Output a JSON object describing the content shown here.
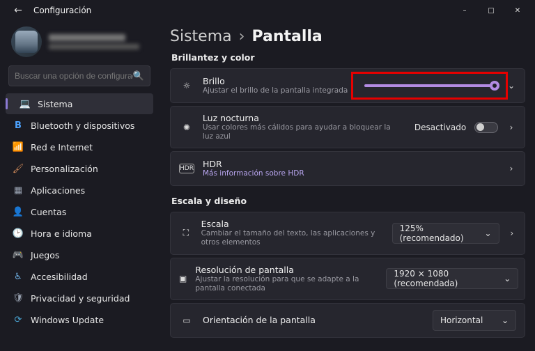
{
  "window": {
    "title": "Configuración",
    "minimize": "–",
    "maximize": "□",
    "close": "✕",
    "back": "←"
  },
  "sidebar": {
    "search_placeholder": "Buscar una opción de configuración",
    "items": [
      {
        "label": "Sistema",
        "icon": "💻",
        "active": true
      },
      {
        "label": "Bluetooth y dispositivos",
        "icon": "B"
      },
      {
        "label": "Red e Internet",
        "icon": "📶"
      },
      {
        "label": "Personalización",
        "icon": "🖌"
      },
      {
        "label": "Aplicaciones",
        "icon": "▦"
      },
      {
        "label": "Cuentas",
        "icon": "👤"
      },
      {
        "label": "Hora e idioma",
        "icon": "🕑"
      },
      {
        "label": "Juegos",
        "icon": "🎮"
      },
      {
        "label": "Accesibilidad",
        "icon": "♿"
      },
      {
        "label": "Privacidad y seguridad",
        "icon": "🛡"
      },
      {
        "label": "Windows Update",
        "icon": "⟳"
      }
    ]
  },
  "main": {
    "breadcrumb": {
      "parent": "Sistema",
      "sep": "›",
      "current": "Pantalla"
    },
    "sections": {
      "brightness_color": "Brillantez y color",
      "scale_layout": "Escala y diseño"
    },
    "brightness": {
      "title": "Brillo",
      "sub": "Ajustar el brillo de la pantalla integrada",
      "icon": "☼",
      "value_percent": 98
    },
    "nightlight": {
      "title": "Luz nocturna",
      "sub": "Usar colores más cálidos para ayudar a bloquear la luz azul",
      "state": "Desactivado",
      "icon": "✺"
    },
    "hdr": {
      "badge": "HDR",
      "title": "HDR",
      "link": "Más información sobre HDR"
    },
    "scale": {
      "title": "Escala",
      "sub": "Cambiar el tamaño del texto, las aplicaciones y otros elementos",
      "value": "125% (recomendado)",
      "icon": "⛶"
    },
    "resolution": {
      "title": "Resolución de pantalla",
      "sub": "Ajustar la resolución para que se adapte a la pantalla conectada",
      "value": "1920 × 1080 (recomendada)",
      "icon": "▣"
    },
    "orientation": {
      "title": "Orientación de la pantalla",
      "value": "Horizontal",
      "icon": "▭"
    }
  }
}
